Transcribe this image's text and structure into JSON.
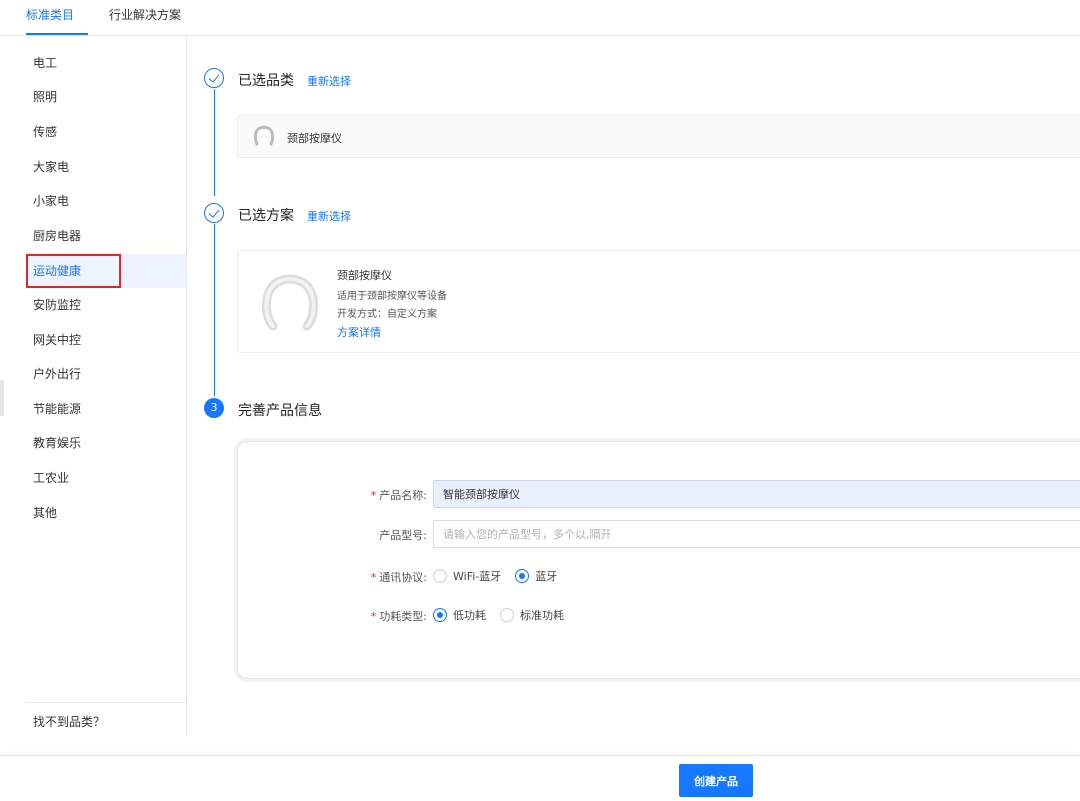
{
  "tabs": [
    {
      "label": "标准类目",
      "active": true
    },
    {
      "label": "行业解决方案",
      "active": false
    }
  ],
  "sidebar": {
    "items": [
      {
        "label": "电工"
      },
      {
        "label": "照明"
      },
      {
        "label": "传感"
      },
      {
        "label": "大家电"
      },
      {
        "label": "小家电"
      },
      {
        "label": "厨房电器"
      },
      {
        "label": "运动健康",
        "active": true
      },
      {
        "label": "安防监控"
      },
      {
        "label": "网关中控"
      },
      {
        "label": "户外出行"
      },
      {
        "label": "节能能源"
      },
      {
        "label": "教育娱乐"
      },
      {
        "label": "工农业"
      },
      {
        "label": "其他"
      }
    ],
    "footer": "找不到品类？"
  },
  "steps": {
    "category": {
      "title": "已选品类",
      "reselect": "重新选择",
      "selected_name": "颈部按摩仪",
      "icon": "neck-massager-icon"
    },
    "plan": {
      "title": "已选方案",
      "reselect": "重新选择",
      "name": "颈部按摩仪",
      "desc": "适用于颈部按摩仪等设备",
      "dev_mode": "开发方式：自定义方案",
      "detail_link": "方案详情",
      "icon": "neck-massager-icon"
    },
    "info": {
      "number": "3",
      "title": "完善产品信息"
    }
  },
  "form": {
    "product_name": {
      "label": "产品名称:",
      "required": true,
      "value": "智能颈部按摩仪"
    },
    "product_model": {
      "label": "产品型号:",
      "required": false,
      "placeholder": "请输入您的产品型号，多个以,隔开"
    },
    "protocol": {
      "label": "通讯协议:",
      "required": true,
      "options": [
        {
          "label": "WiFi-蓝牙",
          "selected": false
        },
        {
          "label": "蓝牙",
          "selected": true
        }
      ]
    },
    "power": {
      "label": "功耗类型:",
      "required": true,
      "options": [
        {
          "label": "低功耗",
          "selected": true
        },
        {
          "label": "标准功耗",
          "selected": false
        }
      ]
    }
  },
  "footer": {
    "create_button": "创建产品"
  },
  "colors": {
    "accent": "#1677ff",
    "highlight_box": "#e3272d",
    "required_star": "#e3272d"
  }
}
